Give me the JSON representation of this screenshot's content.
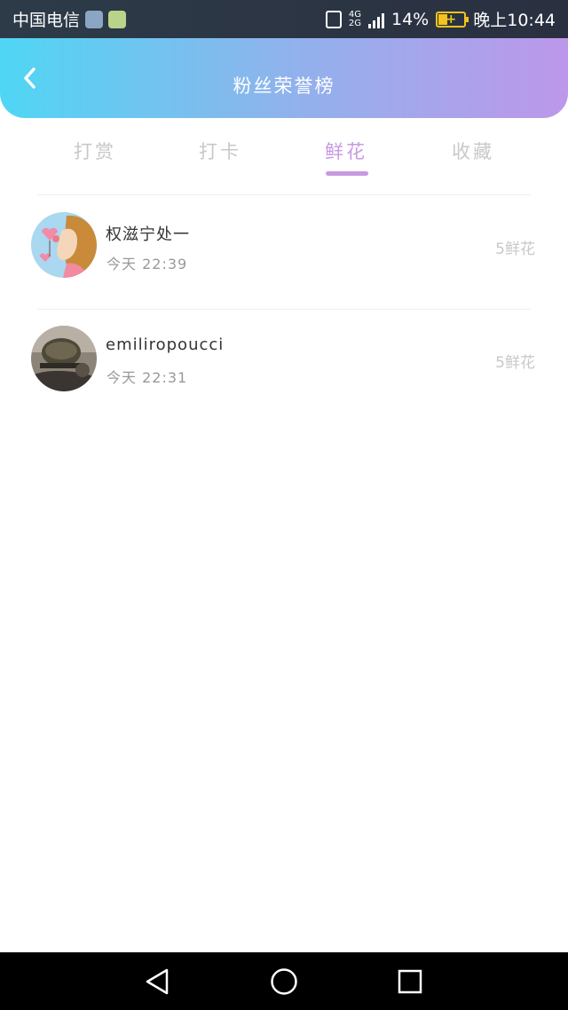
{
  "status_bar": {
    "carrier": "中国电信",
    "network_top": "4G",
    "network_bottom": "2G",
    "battery_percent": "14%",
    "time": "晚上10:44"
  },
  "header": {
    "title": "粉丝荣誉榜",
    "back_icon": "chevron-left-icon"
  },
  "tabs": [
    {
      "label": "打赏"
    },
    {
      "label": "打卡"
    },
    {
      "label": "鲜花"
    },
    {
      "label": "收藏"
    }
  ],
  "active_tab": 2,
  "list": [
    {
      "name": "权滋宁处一",
      "time": "今天 22:39",
      "amount": "5鲜花",
      "avatar": "cartoon-girl-avatar"
    },
    {
      "name": "emiliropoucci",
      "time": "今天 22:31",
      "amount": "5鲜花",
      "avatar": "soldier-photo-avatar"
    }
  ],
  "navbar": {
    "back_icon": "triangle-back-icon",
    "home_icon": "circle-home-icon",
    "recents_icon": "square-recents-icon"
  },
  "colors": {
    "gradient_start": "#4fd6f4",
    "gradient_end": "#bd97ea",
    "accent": "#c79ae0"
  }
}
